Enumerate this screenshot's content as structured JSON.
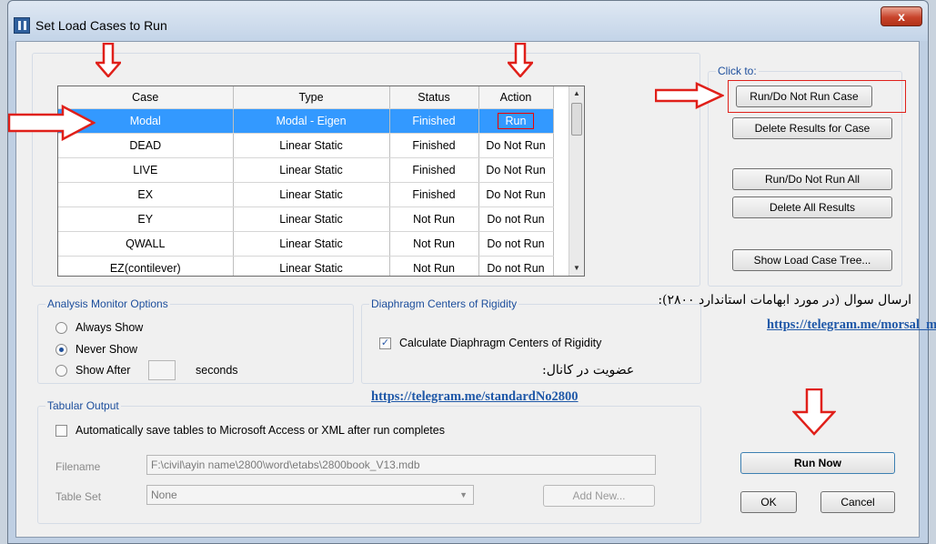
{
  "window": {
    "title": "Set Load Cases to Run",
    "close_label": "x"
  },
  "cases_table": {
    "columns": [
      "Case",
      "Type",
      "Status",
      "Action"
    ],
    "rows": [
      {
        "case": "Modal",
        "type": "Modal - Eigen",
        "status": "Finished",
        "action": "Run",
        "selected": true
      },
      {
        "case": "DEAD",
        "type": "Linear Static",
        "status": "Finished",
        "action": "Do Not Run"
      },
      {
        "case": "LIVE",
        "type": "Linear Static",
        "status": "Finished",
        "action": "Do Not Run"
      },
      {
        "case": "EX",
        "type": "Linear Static",
        "status": "Finished",
        "action": "Do Not Run"
      },
      {
        "case": "EY",
        "type": "Linear Static",
        "status": "Not Run",
        "action": "Do not Run"
      },
      {
        "case": "QWALL",
        "type": "Linear Static",
        "status": "Not Run",
        "action": "Do not Run"
      },
      {
        "case": "EZ(contilever)",
        "type": "Linear Static",
        "status": "Not Run",
        "action": "Do not Run"
      }
    ]
  },
  "click_to": {
    "label": "Click to:",
    "run_do_not_run_case": "Run/Do Not Run Case",
    "delete_results_for_case": "Delete Results for Case",
    "run_do_not_run_all": "Run/Do Not Run All",
    "delete_all_results": "Delete All Results",
    "show_load_case_tree": "Show Load Case Tree..."
  },
  "analysis_monitor": {
    "label": "Analysis Monitor Options",
    "always_show": "Always Show",
    "never_show": "Never Show",
    "show_after": "Show After",
    "seconds": "seconds",
    "selected": "never_show"
  },
  "diaphragm": {
    "label": "Diaphragm Centers of Rigidity",
    "calculate": "Calculate Diaphragm Centers of Rigidity",
    "checked": true
  },
  "tabular_output": {
    "label": "Tabular Output",
    "auto_save": "Automatically save tables to Microsoft Access or XML after run completes",
    "filename_label": "Filename",
    "filename_value": "F:\\civil\\ayin name\\2800\\word\\etabs\\2800book_V13.mdb",
    "table_set_label": "Table Set",
    "table_set_value": "None",
    "add_new": "Add New..."
  },
  "actions": {
    "run_now": "Run Now",
    "ok": "OK",
    "cancel": "Cancel"
  },
  "overlay": {
    "question_text": "ارسال سوال (در مورد ابهامات استاندارد ۲۸۰۰):",
    "question_link": "https://telegram.me/morsal_mottaghi",
    "channel_text": "عضویت در کانال:",
    "channel_link": "https://telegram.me/standardNo2800"
  },
  "colors": {
    "annotation_red": "#e0201a",
    "selection_blue": "#3399ff",
    "group_label_blue": "#1c4e9c",
    "link_blue": "#1f58a8"
  }
}
